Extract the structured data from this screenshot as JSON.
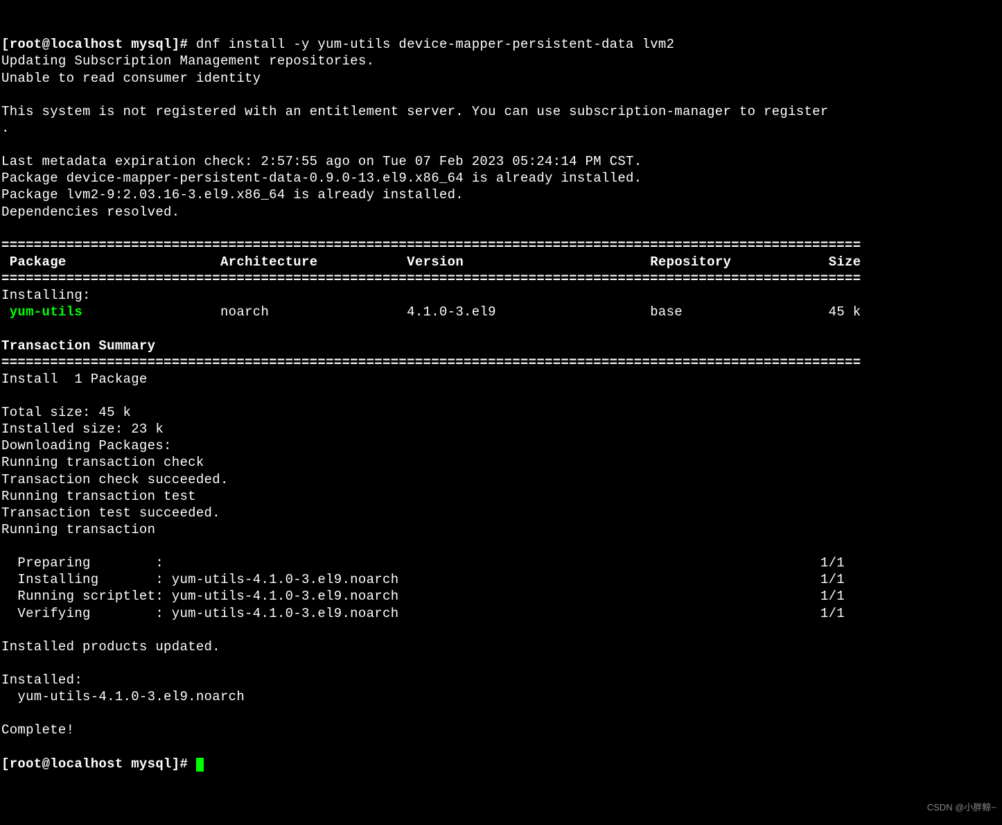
{
  "prompt_start": "[root@localhost mysql]# ",
  "command": "dnf install -y yum-utils device-mapper-persistent-data lvm2",
  "preamble": [
    "Updating Subscription Management repositories.",
    "Unable to read consumer identity",
    "",
    "This system is not registered with an entitlement server. You can use subscription-manager to register",
    ".",
    "",
    "Last metadata expiration check: 2:57:55 ago on Tue 07 Feb 2023 05:24:14 PM CST.",
    "Package device-mapper-persistent-data-0.9.0-13.el9.x86_64 is already installed.",
    "Package lvm2-9:2.03.16-3.el9.x86_64 is already installed.",
    "Dependencies resolved."
  ],
  "table_header_line": "==========================================================================================================",
  "table_headers": {
    "package": " Package",
    "arch": "Architecture",
    "version": "Version",
    "repo": "Repository",
    "size": "Size"
  },
  "installing_label": "Installing:",
  "package_row": {
    "name": " yum-utils",
    "arch": "noarch",
    "version": "4.1.0-3.el9",
    "repo": "base",
    "size": "45 k"
  },
  "summary_label": "Transaction Summary",
  "install_count": "Install  1 Package",
  "footer_lines": [
    "",
    "Total size: 45 k",
    "Installed size: 23 k",
    "Downloading Packages:",
    "Running transaction check",
    "Transaction check succeeded.",
    "Running transaction test",
    "Transaction test succeeded.",
    "Running transaction"
  ],
  "transaction_steps": [
    {
      "step": "  Preparing        :                                                                                 ",
      "count": "1/1"
    },
    {
      "step": "  Installing       : yum-utils-4.1.0-3.el9.noarch                                                    ",
      "count": "1/1"
    },
    {
      "step": "  Running scriptlet: yum-utils-4.1.0-3.el9.noarch                                                    ",
      "count": "1/1"
    },
    {
      "step": "  Verifying        : yum-utils-4.1.0-3.el9.noarch                                                    ",
      "count": "1/1"
    }
  ],
  "post_transaction": [
    "Installed products updated.",
    "",
    "Installed:",
    "  yum-utils-4.1.0-3.el9.noarch",
    "",
    "Complete!"
  ],
  "prompt_end": "[root@localhost mysql]# ",
  "watermark": "CSDN @小胖鲸~"
}
